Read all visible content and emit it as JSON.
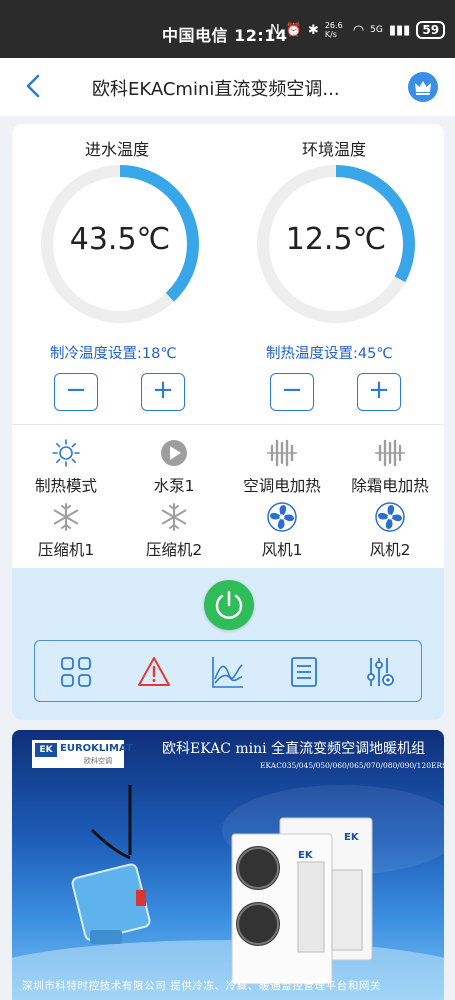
{
  "status_bar": {
    "carrier_time": "中国电信 12:14",
    "net_speed": "26.6 K/s",
    "network": "5G",
    "battery": "59"
  },
  "nav": {
    "title": "欧科EKACmini直流变频空调..."
  },
  "gauges": [
    {
      "label": "进水温度",
      "value": "43.5℃",
      "fill_fraction": 0.38,
      "setting": "制冷温度设置:18℃"
    },
    {
      "label": "环境温度",
      "value": "12.5℃",
      "fill_fraction": 0.33,
      "setting": "制热温度设置:45℃"
    }
  ],
  "stepper": {
    "minus": "−",
    "plus": "+"
  },
  "status_items": [
    {
      "label": "制热模式",
      "icon": "sun-icon"
    },
    {
      "label": "水泵1",
      "icon": "pump-play-icon"
    },
    {
      "label": "空调电加热",
      "icon": "heater-icon"
    },
    {
      "label": "除霜电加热",
      "icon": "heater-icon"
    },
    {
      "label": "压缩机1",
      "icon": "snowflake-icon"
    },
    {
      "label": "压缩机2",
      "icon": "snowflake-icon"
    },
    {
      "label": "风机1",
      "icon": "fan-icon"
    },
    {
      "label": "风机2",
      "icon": "fan-icon"
    }
  ],
  "toolbar": [
    "grid-icon",
    "alarm-icon",
    "chart-icon",
    "list-icon",
    "settings-icon"
  ],
  "banner": {
    "brand": "EUROKLIMAT",
    "brand_logo": "EK",
    "brand_sub": "欧科空调",
    "title": "欧科EKAC mini 全直流变频空调地暖机组",
    "models": "EKAC035/045/050/060/065/070/080/090/120ERSH-APA",
    "footer": "深圳市科特时控技术有限公司   提供冷冻、冷藏、暖通监控管理平台和网关"
  },
  "colors": {
    "accent_blue": "#2a7ad8",
    "gauge_fill": "#3aa6ea",
    "gauge_track": "#eeeeee",
    "power_green": "#2ebd59",
    "alarm_red": "#e53935",
    "panel_bg": "#d9ecfb"
  }
}
